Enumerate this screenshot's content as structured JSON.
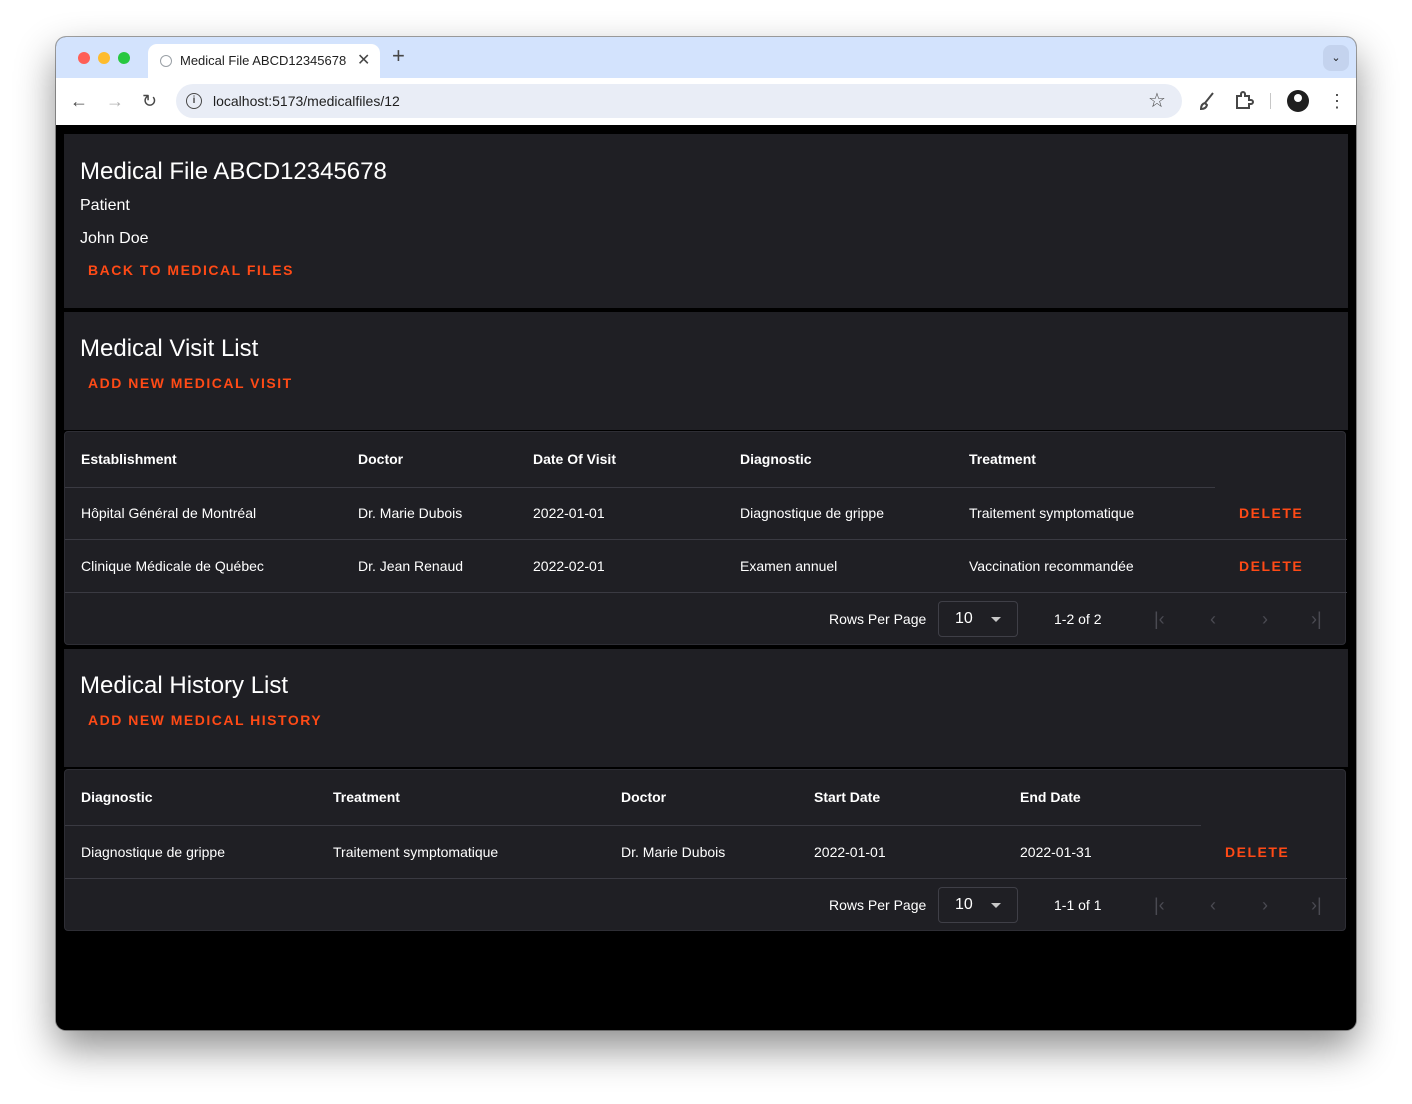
{
  "browser": {
    "tab_title": "Medical File ABCD12345678",
    "tab_close": "✕",
    "new_tab": "+",
    "tab_menu": "⌄",
    "url": "localhost:5173/medicalfiles/12",
    "icons": [
      "back-icon",
      "forward-icon",
      "reload-icon",
      "info-icon",
      "star-icon",
      "brush-icon",
      "extensions-icon",
      "profile-icon",
      "more-icon"
    ]
  },
  "header": {
    "title": "Medical File ABCD12345678",
    "patient_label": "Patient",
    "patient_name": "John Doe",
    "back_button": "BACK TO MEDICAL FILES"
  },
  "visits": {
    "title": "Medical Visit List",
    "add_button": "ADD NEW MEDICAL VISIT",
    "columns": [
      "Establishment",
      "Doctor",
      "Date Of Visit",
      "Diagnostic",
      "Treatment"
    ],
    "rows": [
      {
        "establishment": "Hôpital Général de Montréal",
        "doctor": "Dr. Marie Dubois",
        "date": "2022-01-01",
        "diagnostic": "Diagnostique de grippe",
        "treatment": "Traitement symptomatique",
        "action": "DELETE"
      },
      {
        "establishment": "Clinique Médicale de Québec",
        "doctor": "Dr. Jean Renaud",
        "date": "2022-02-01",
        "diagnostic": "Examen annuel",
        "treatment": "Vaccination recommandée",
        "action": "DELETE"
      }
    ],
    "rows_per_page_label": "Rows Per Page",
    "rows_per_page": "10",
    "range": "1-2 of 2"
  },
  "history": {
    "title": "Medical History List",
    "add_button": "ADD NEW MEDICAL HISTORY",
    "columns": [
      "Diagnostic",
      "Treatment",
      "Doctor",
      "Start Date",
      "End Date"
    ],
    "rows": [
      {
        "diagnostic": "Diagnostique de grippe",
        "treatment": "Traitement symptomatique",
        "doctor": "Dr. Marie Dubois",
        "start": "2022-01-01",
        "end": "2022-01-31",
        "action": "DELETE"
      }
    ],
    "rows_per_page_label": "Rows Per Page",
    "rows_per_page": "10",
    "range": "1-1 of 1"
  },
  "colors": {
    "accent": "#ff4a16",
    "panel": "#1f1f24",
    "background": "#000000"
  }
}
